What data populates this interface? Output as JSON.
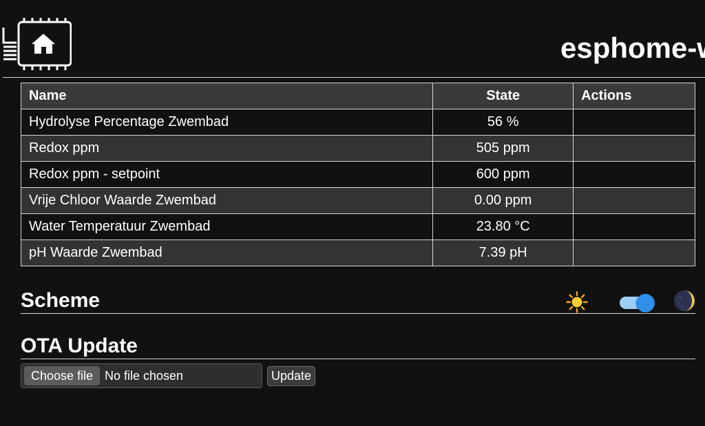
{
  "header": {
    "title": "esphome-w",
    "logo_icon": "esphome-home-chip-icon"
  },
  "table": {
    "columns": [
      "Name",
      "State",
      "Actions"
    ],
    "rows": [
      {
        "name": "Hydrolyse Percentage Zwembad",
        "state": "56 %",
        "actions": ""
      },
      {
        "name": "Redox ppm",
        "state": "505 ppm",
        "actions": ""
      },
      {
        "name": "Redox ppm - setpoint",
        "state": "600 ppm",
        "actions": ""
      },
      {
        "name": "Vrije Chloor Waarde Zwembad",
        "state": "0.00 ppm",
        "actions": ""
      },
      {
        "name": "Water Temperatuur Zwembad",
        "state": "23.80 °C",
        "actions": ""
      },
      {
        "name": "pH Waarde Zwembad",
        "state": "7.39 pH",
        "actions": ""
      }
    ]
  },
  "scheme": {
    "title": "Scheme",
    "light_icon": "sun-icon",
    "dark_icon": "moon-icon",
    "toggle_state": "dark",
    "toggle_color": "#2f8fea"
  },
  "ota": {
    "title": "OTA Update",
    "choose_file_label": "Choose file",
    "file_status": "No file chosen",
    "update_label": "Update"
  },
  "colors": {
    "background": "#111111",
    "row_alt": "#333333",
    "header_row": "#3a3a3a",
    "text": "#ffffff"
  }
}
